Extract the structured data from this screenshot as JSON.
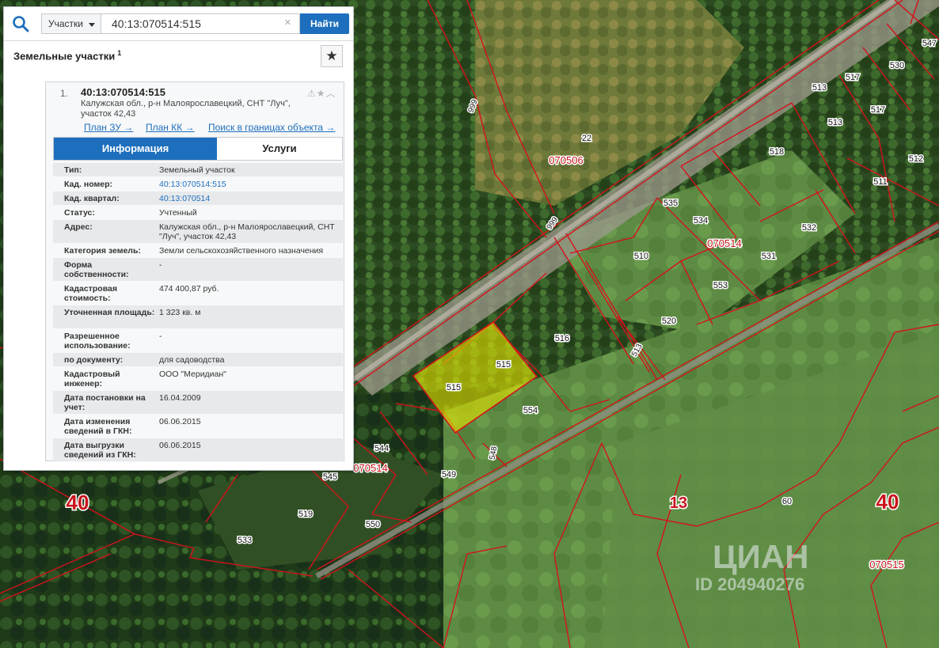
{
  "search": {
    "category": "Участки",
    "query": "40:13:070514:515",
    "find_label": "Найти",
    "clear_glyph": "×"
  },
  "results": {
    "title": "Земельные участки",
    "count": "1"
  },
  "item": {
    "number": "1.",
    "cad_number": "40:13:070514:515",
    "address": "Калужская обл., р-н Малоярославецкий, СНТ \"Луч\", участок 42,43",
    "links": [
      "План ЗУ →",
      "План КК →",
      "Поиск в границах объекта →"
    ],
    "tabs": [
      "Информация",
      "Услуги"
    ],
    "fields": [
      {
        "k": "Тип:",
        "v": "Земельный участок"
      },
      {
        "k": "Кад. номер:",
        "v": "40:13:070514:515",
        "link": true
      },
      {
        "k": "Кад. квартал:",
        "v": "40:13:070514",
        "link": true
      },
      {
        "k": "Статус:",
        "v": "Учтенный"
      },
      {
        "k": "Адрес:",
        "v": "Калужская обл., р-н Малоярославецкий, СНТ \"Луч\", участок 42,43"
      },
      {
        "k": "Категория земель:",
        "v": "Земли сельскохозяйственного назначения"
      },
      {
        "k": "Форма собственности:",
        "v": "-"
      },
      {
        "k": "Кадастровая стоимость:",
        "v": "474 400,87 руб."
      },
      {
        "k": "Уточненная площадь:",
        "v": "1 323 кв. м"
      },
      {
        "k": "Разрешенное использование:",
        "v": "-"
      },
      {
        "k": "по документу:",
        "v": "для садоводства"
      },
      {
        "k": "Кадастровый инженер:",
        "v": "ООО \"Меридиан\""
      },
      {
        "k": "Дата постановки на учет:",
        "v": "16.04.2009"
      },
      {
        "k": "Дата изменения сведений в ГКН:",
        "v": "06.06.2015"
      },
      {
        "k": "Дата выгрузки сведений из ГКН:",
        "v": "06.06.2015"
      }
    ]
  },
  "map": {
    "labels": [
      "547",
      "530",
      "513",
      "517",
      "513",
      "517",
      "22",
      "070506",
      "518",
      "512",
      "511",
      "535",
      "534",
      "532",
      "999",
      "510",
      "070514",
      "531",
      "999",
      "553",
      "520",
      "516",
      "515",
      "515",
      "554",
      "544",
      "070514",
      "549",
      "545",
      "519",
      "550",
      "533",
      "040",
      "070515",
      "13",
      "60",
      "40",
      "40",
      "070506"
    ],
    "big_labels": [
      "40",
      "40",
      "13"
    ],
    "quarter_labels": [
      "070506",
      "070514",
      "070514",
      "070515",
      "07050"
    ],
    "selected_parcel": "515",
    "watermark_brand": "ЦИАН",
    "watermark_id": "ID 204940276",
    "colors": {
      "boundary": "#d4121c",
      "selected_fill": "#e6e600",
      "road": "#b9b3a6"
    }
  }
}
